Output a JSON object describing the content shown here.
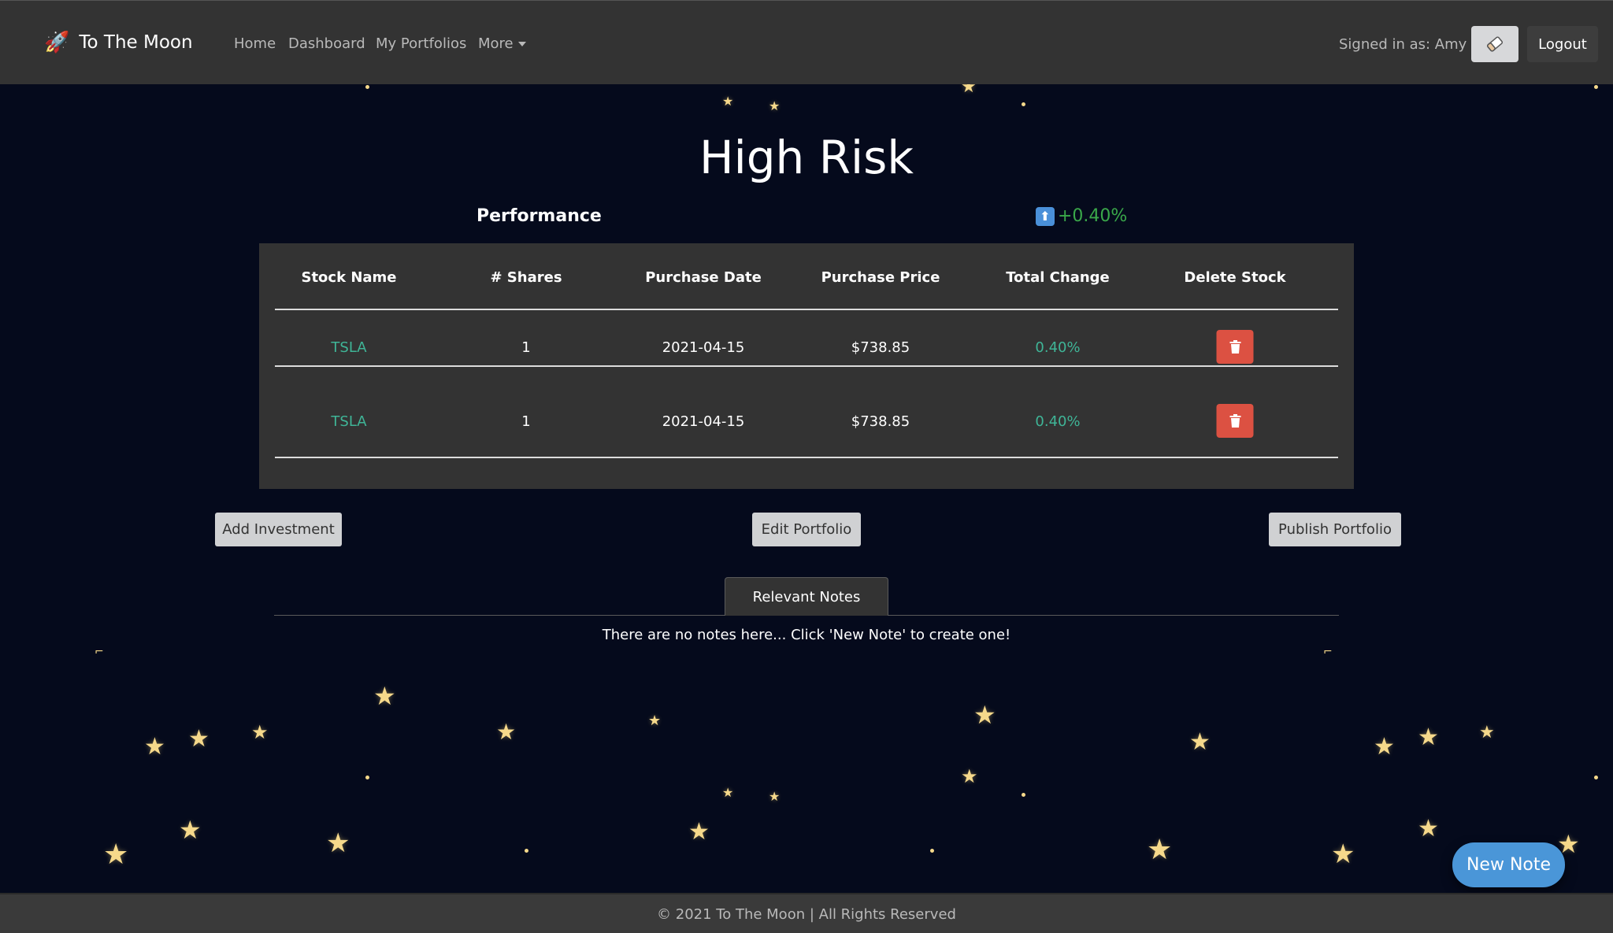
{
  "navbar": {
    "brand_icon": "🚀",
    "brand": "To The Moon",
    "links": [
      "Home",
      "Dashboard",
      "My Portfolios"
    ],
    "more": "More",
    "signed_in": "Signed in as: Amy",
    "notes_icon": "eraser-icon",
    "logout": "Logout"
  },
  "portfolio": {
    "title": "High Risk",
    "performance_label": "Performance",
    "performance_arrow": "⬆",
    "performance_value": "+0.40%"
  },
  "table": {
    "headers": [
      "Stock Name",
      "# Shares",
      "Purchase Date",
      "Purchase Price",
      "Total Change",
      "Delete Stock"
    ],
    "rows": [
      {
        "stock": "TSLA",
        "shares": "1",
        "date": "2021-04-15",
        "price": "$738.85",
        "change": "0.40%"
      },
      {
        "stock": "TSLA",
        "shares": "1",
        "date": "2021-04-15",
        "price": "$738.85",
        "change": "0.40%"
      }
    ]
  },
  "actions": {
    "add": "Add Investment",
    "edit": "Edit Portfolio",
    "publish": "Publish Portfolio"
  },
  "notes": {
    "tab": "Relevant Notes",
    "empty": "There are no notes here... Click 'New Note' to create one!",
    "new_note": "New Note"
  },
  "footer": {
    "text": "© 2021 To The Moon | All Rights Reserved"
  },
  "colors": {
    "navbar": "#333333",
    "background": "#050a1c",
    "positive": "#3aa84a",
    "link": "#3fb597",
    "delete": "#dc5142",
    "new_note": "#4a96d8"
  }
}
